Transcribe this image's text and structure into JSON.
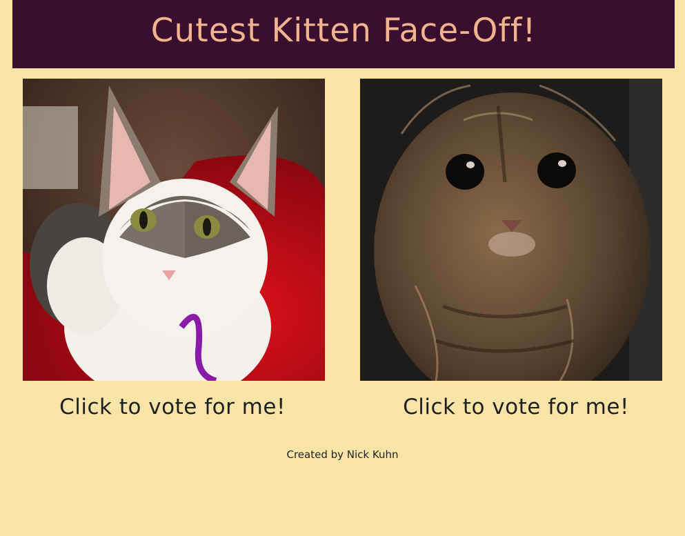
{
  "header": {
    "title": "Cutest Kitten Face-Off!"
  },
  "kittens": [
    {
      "image": "kitten-1-photo",
      "vote_label": "Click to vote for me!"
    },
    {
      "image": "kitten-2-photo",
      "vote_label": "Click to vote for me!"
    }
  ],
  "footer": {
    "credit": "Created by Nick Kuhn"
  },
  "colors": {
    "page_background": "#f9e4a8",
    "header_background": "#3a0e2e",
    "title_text": "#f2b48e",
    "body_text": "#1f1f1f"
  }
}
